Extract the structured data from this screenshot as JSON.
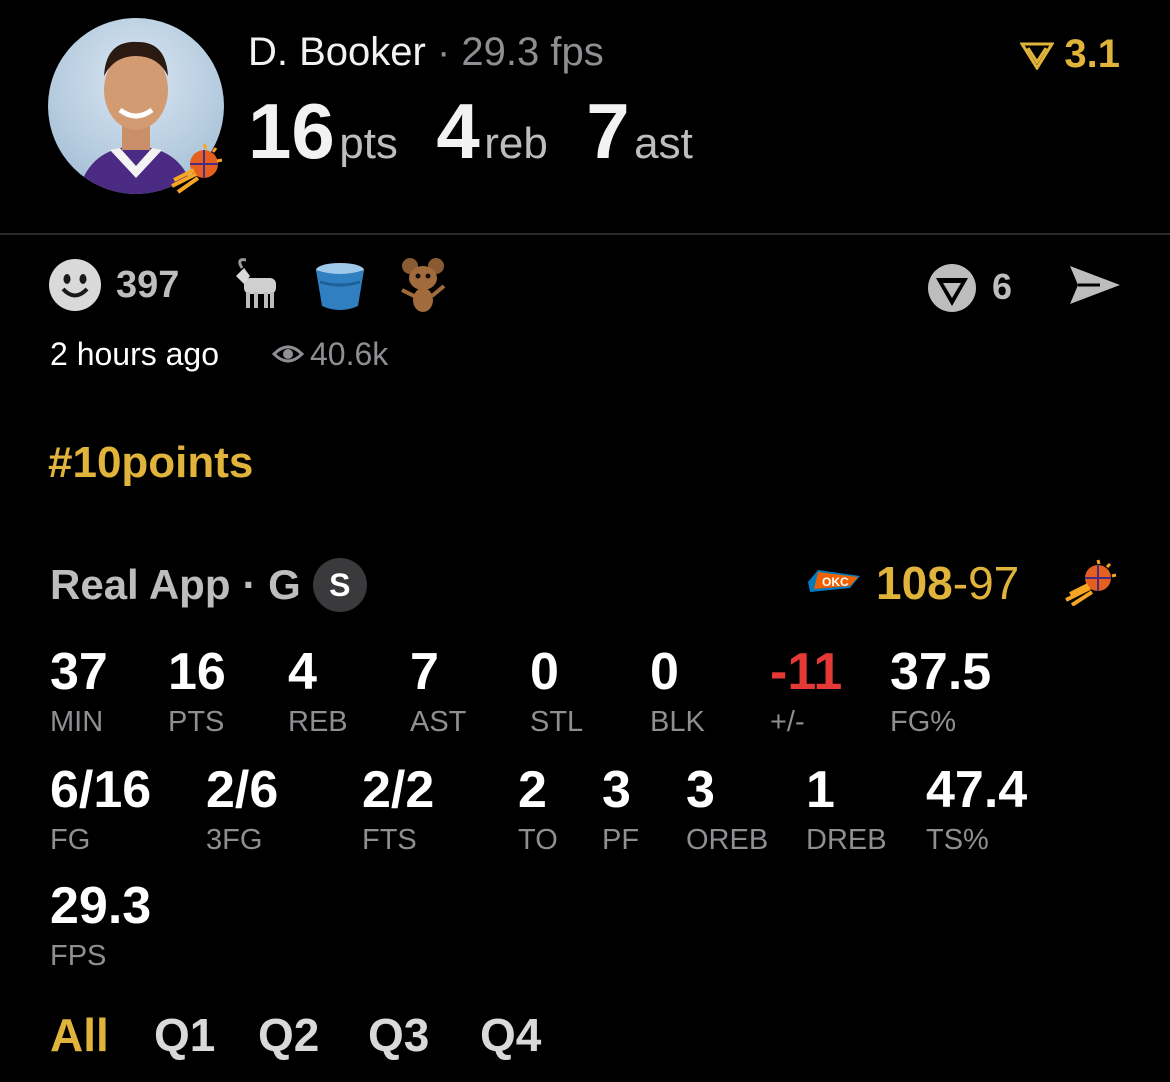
{
  "player": {
    "name": "D. Booker",
    "fps_line": "· 29.3 fps",
    "pts": "16",
    "pts_label": "pts",
    "reb": "4",
    "reb_label": "reb",
    "ast": "7",
    "ast_label": "ast"
  },
  "rating": {
    "value": "3.1"
  },
  "reactions": {
    "count": "397",
    "shares": "6",
    "time": "2 hours ago",
    "views": "40.6k"
  },
  "hashtag": "#10points",
  "game": {
    "source": "Real App",
    "pos": "· G",
    "badge": "S",
    "score_win": "108",
    "score_sep": "-",
    "score_loss": "97"
  },
  "stats_row1": [
    {
      "v": "37",
      "l": "MIN"
    },
    {
      "v": "16",
      "l": "PTS"
    },
    {
      "v": "4",
      "l": "REB"
    },
    {
      "v": "7",
      "l": "AST"
    },
    {
      "v": "0",
      "l": "STL"
    },
    {
      "v": "0",
      "l": "BLK"
    },
    {
      "v": "-11",
      "l": "+/-"
    },
    {
      "v": "37.5",
      "l": "FG%"
    }
  ],
  "stats_row2": [
    {
      "v": "6/16",
      "l": "FG"
    },
    {
      "v": "2/6",
      "l": "3FG"
    },
    {
      "v": "2/2",
      "l": "FTS"
    },
    {
      "v": "2",
      "l": "TO"
    },
    {
      "v": "3",
      "l": "PF"
    },
    {
      "v": "3",
      "l": "OREB"
    },
    {
      "v": "1",
      "l": "DREB"
    },
    {
      "v": "47.4",
      "l": "TS%"
    }
  ],
  "stats_row3": [
    {
      "v": "29.3",
      "l": "FPS"
    }
  ],
  "tabs": [
    "All",
    "Q1",
    "Q2",
    "Q3",
    "Q4"
  ],
  "colors": {
    "gold": "#e0b43a",
    "negative": "#e53935",
    "gray": "#8e8e93"
  },
  "icons": [
    "smiley-icon",
    "goat-icon",
    "bucket-icon",
    "cartoon-mouse-icon",
    "real-logo-icon",
    "send-icon",
    "eye-icon",
    "okc-logo-icon",
    "suns-logo-icon",
    "rating-logo-icon"
  ]
}
